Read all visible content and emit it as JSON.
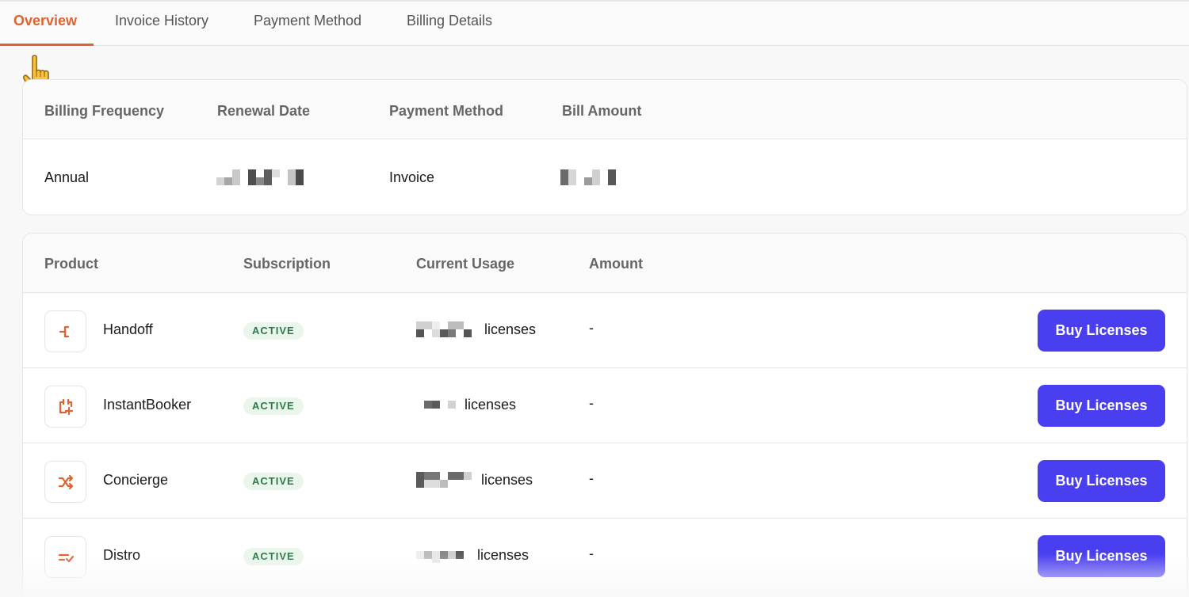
{
  "tabs": [
    {
      "label": "Overview",
      "active": true
    },
    {
      "label": "Invoice History",
      "active": false
    },
    {
      "label": "Payment Method",
      "active": false
    },
    {
      "label": "Billing Details",
      "active": false
    }
  ],
  "summary": {
    "headers": {
      "frequency": "Billing Frequency",
      "renewal": "Renewal Date",
      "payment": "Payment Method",
      "amount": "Bill Amount"
    },
    "values": {
      "frequency": "Annual",
      "payment": "Invoice"
    }
  },
  "products": {
    "headers": {
      "product": "Product",
      "subscription": "Subscription",
      "usage": "Current Usage",
      "amount": "Amount"
    },
    "rows": [
      {
        "name": "Handoff",
        "icon": "handoff-icon",
        "status": "ACTIVE",
        "usage_unit": "licenses",
        "amount": "-",
        "button": "Buy Licenses"
      },
      {
        "name": "InstantBooker",
        "icon": "calendar-plus-icon",
        "status": "ACTIVE",
        "usage_unit": "licenses",
        "amount": "-",
        "button": "Buy Licenses"
      },
      {
        "name": "Concierge",
        "icon": "shuffle-icon",
        "status": "ACTIVE",
        "usage_unit": "licenses",
        "amount": "-",
        "button": "Buy Licenses"
      },
      {
        "name": "Distro",
        "icon": "list-check-icon",
        "status": "ACTIVE",
        "usage_unit": "licenses",
        "amount": "-",
        "button": "Buy Licenses"
      }
    ]
  },
  "colors": {
    "accent": "#e0622f",
    "button": "#4a3ff0",
    "badge_bg": "#eaf5ec",
    "badge_text": "#2b7a47"
  },
  "cursor": "pointing-hand-icon"
}
